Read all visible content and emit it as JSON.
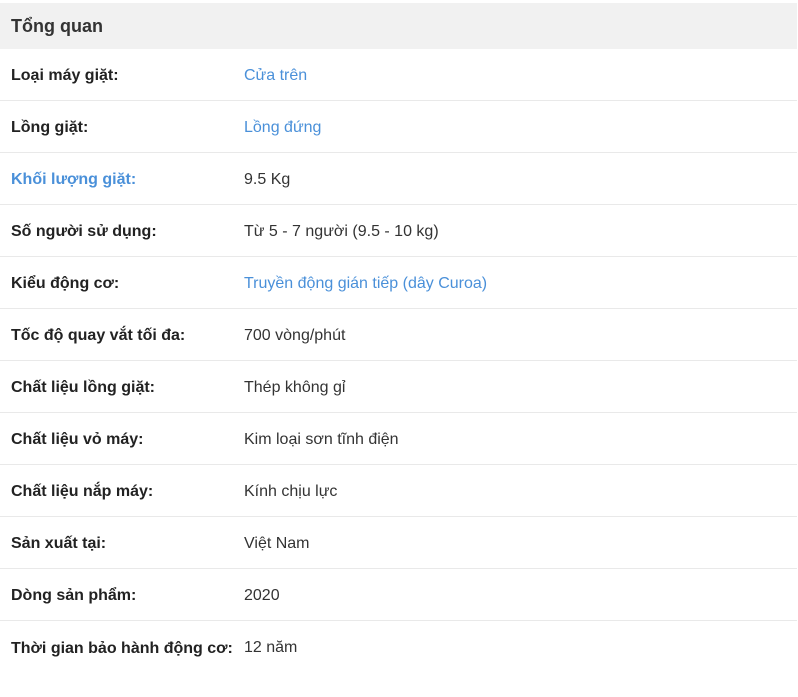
{
  "section": {
    "title": "Tổng quan"
  },
  "specs": [
    {
      "label": "Loại máy giặt:",
      "value": "Cửa trên"
    },
    {
      "label": "Lồng giặt:",
      "value": "Lồng đứng"
    },
    {
      "label": "Khối lượng giặt:",
      "value": "9.5 Kg"
    },
    {
      "label": "Số người sử dụng:",
      "value": "Từ 5 - 7 người (9.5 - 10 kg)"
    },
    {
      "label": "Kiểu động cơ:",
      "value": "Truyền động gián tiếp (dây Curoa)"
    },
    {
      "label": "Tốc độ quay vắt tối đa:",
      "value": "700 vòng/phút"
    },
    {
      "label": "Chất liệu lồng giặt:",
      "value": "Thép không gỉ"
    },
    {
      "label": "Chất liệu vỏ máy:",
      "value": "Kim loại sơn tĩnh điện"
    },
    {
      "label": "Chất liệu nắp máy:",
      "value": "Kính chịu lực"
    },
    {
      "label": "Sản xuất tại:",
      "value": "Việt Nam"
    },
    {
      "label": "Dòng sản phẩm:",
      "value": "2020"
    },
    {
      "label": "Thời gian bảo hành động cơ:",
      "value": "12 năm"
    }
  ],
  "colors": {
    "link": "#4a90d9",
    "header_bg": "#f1f1f1",
    "divider": "#e9e9e9"
  }
}
